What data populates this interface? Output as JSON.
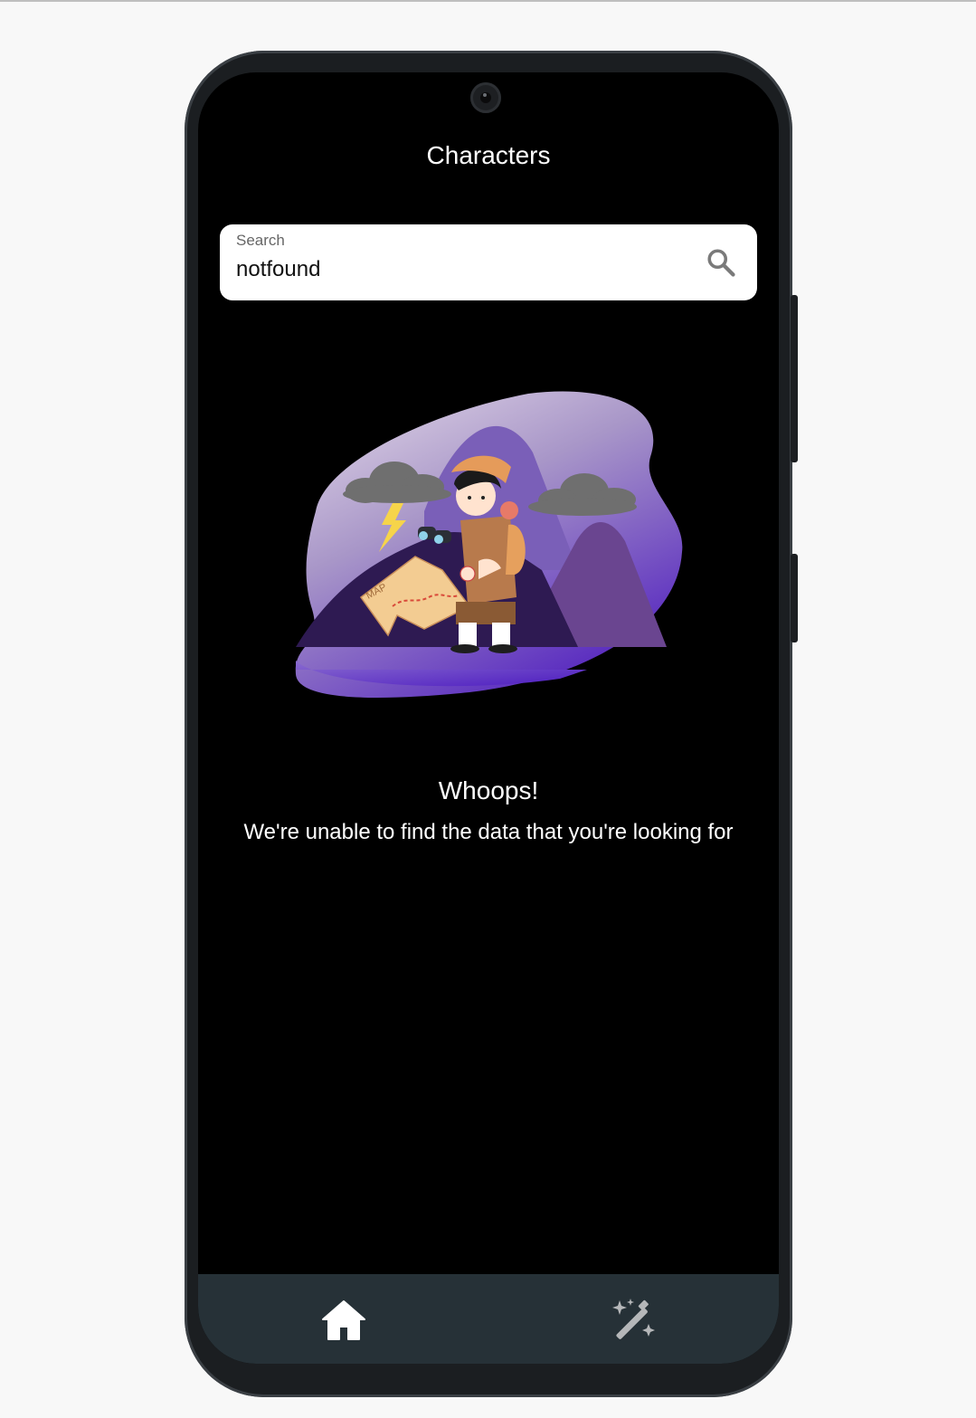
{
  "app": {
    "title": "Characters"
  },
  "search": {
    "label": "Search",
    "value": "notfound",
    "icon": "search-icon"
  },
  "empty_state": {
    "title": "Whoops!",
    "message": "We're unable to find the data that you're looking for",
    "illustration": "explorer-with-map-illustration",
    "illustration_text": "MAP"
  },
  "bottom_nav": {
    "items": [
      {
        "icon": "home-icon",
        "active": true
      },
      {
        "icon": "magic-wand-icon",
        "active": false
      }
    ]
  },
  "colors": {
    "background": "#000000",
    "nav_background": "#263137",
    "accent_purple": "#6a3fc2",
    "text": "#ffffff"
  }
}
